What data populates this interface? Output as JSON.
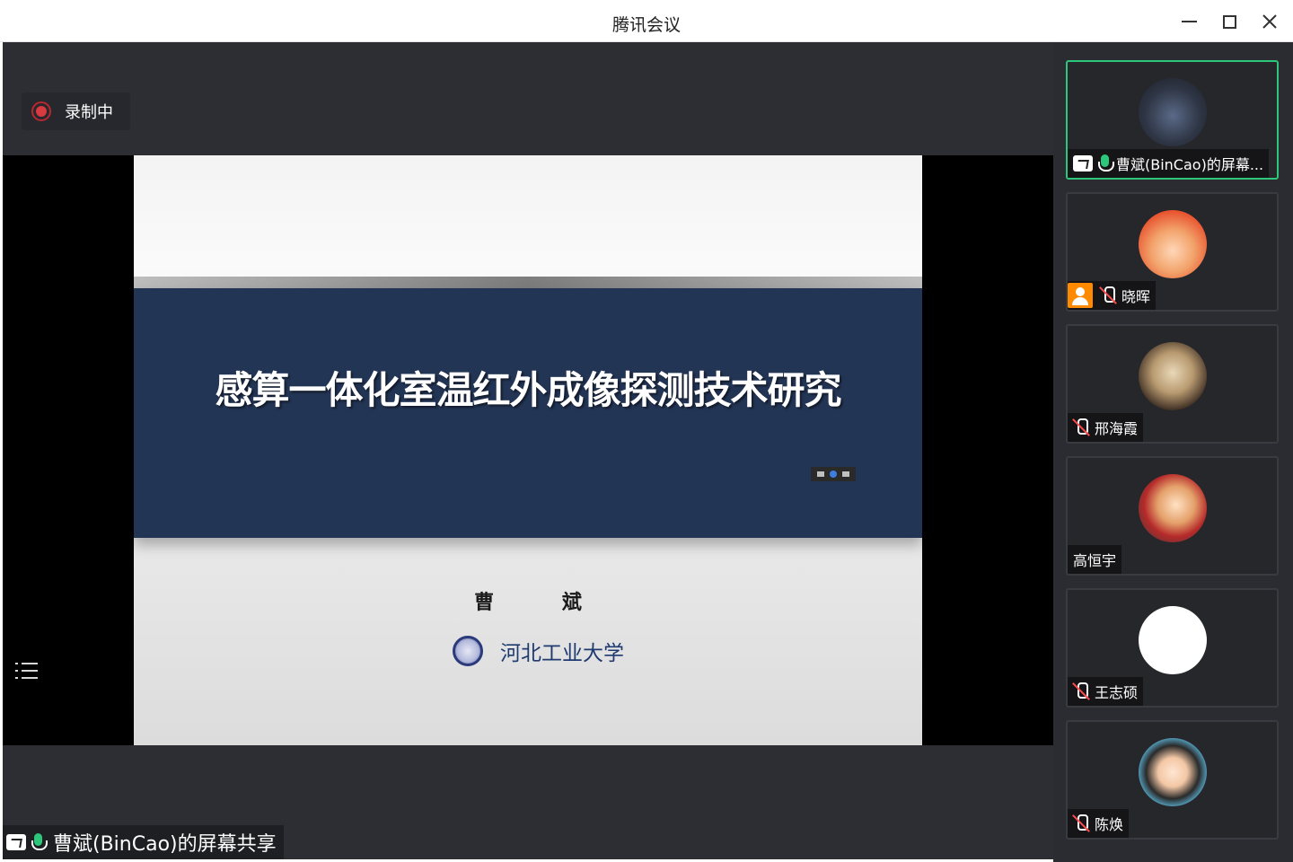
{
  "window": {
    "title": "腾讯会议"
  },
  "stage": {
    "recording_label": "录制中",
    "share_caption": "曹斌(BinCao)的屏幕共享"
  },
  "slide": {
    "title": "感算一体化室温红外成像探测技术研究",
    "author": "曹  斌",
    "school": "河北工业大学"
  },
  "participants": [
    {
      "name": "曹斌(BinCao)的屏幕...",
      "mic": "on",
      "sharing": true,
      "avatar": "presenter-photo"
    },
    {
      "name": "晓晖",
      "mic": "off",
      "avatar": "cartoon-girl"
    },
    {
      "name": "邢海霞",
      "mic": "off",
      "avatar": "silhouette-photo"
    },
    {
      "name": "高恒宇",
      "mic": "none",
      "avatar": "cartoon-character"
    },
    {
      "name": "王志硕",
      "mic": "off",
      "avatar": "white-circle"
    },
    {
      "name": "陈焕",
      "mic": "off",
      "avatar": "cartoon-woman"
    }
  ],
  "colors": {
    "slide_band": "#233555",
    "active_speaker_border": "#2cc77a",
    "recording_red": "#d83a3f"
  }
}
